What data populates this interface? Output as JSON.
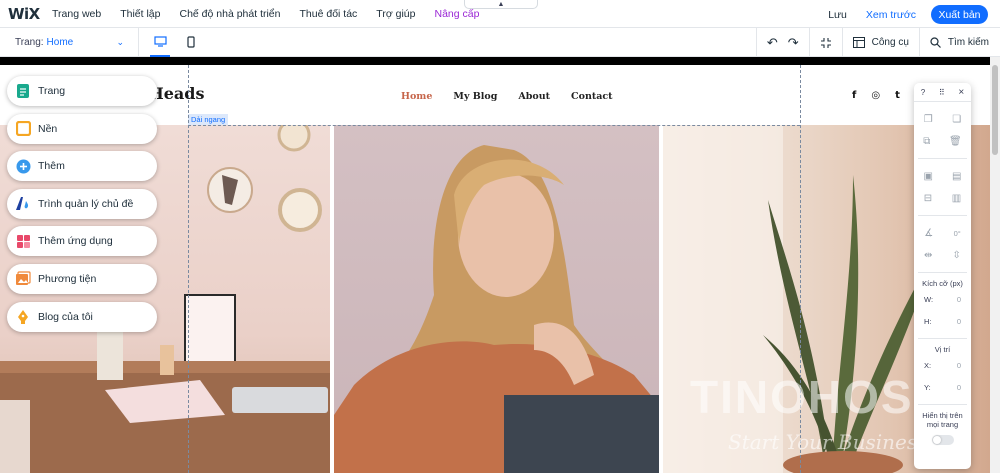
{
  "topbar": {
    "logo": "WiX",
    "menu": [
      "Trang web",
      "Thiết lập",
      "Chế độ nhà phát triển",
      "Thuê đối tác",
      "Trợ giúp",
      "Nâng cấp"
    ],
    "save": "Lưu",
    "preview": "Xem trước",
    "publish": "Xuất bản"
  },
  "toolbar": {
    "page_label": "Trang:",
    "page_value": "Home",
    "tools_label": "Công cụ",
    "search_label": "Tìm kiếm"
  },
  "site": {
    "title": "Turning Heads",
    "nav": [
      "Home",
      "My Blog",
      "About",
      "Contact"
    ],
    "social": [
      "f",
      "◎",
      "t"
    ],
    "strip_tag": "Dải ngang"
  },
  "left_panel": [
    {
      "label": "Trang",
      "icon": "page-icon",
      "color": "#19a98d"
    },
    {
      "label": "Nền",
      "icon": "background-icon",
      "color": "#f5a623"
    },
    {
      "label": "Thêm",
      "icon": "add-icon",
      "color": "#3899ec"
    },
    {
      "label": "Trình quản lý chủ đề",
      "icon": "theme-manager-icon",
      "color": "#1d3fa0"
    },
    {
      "label": "Thêm ứng dụng",
      "icon": "add-apps-icon",
      "color": "#e8496a"
    },
    {
      "label": "Phương tiện",
      "icon": "media-icon",
      "color": "#f08a3c"
    },
    {
      "label": "Blog của tôi",
      "icon": "blog-icon",
      "color": "#f5a623"
    }
  ],
  "right_panel": {
    "help": "?",
    "close": "×",
    "size_title": "Kích cỡ (px)",
    "w_label": "W:",
    "w_value": "0",
    "h_label": "H:",
    "h_value": "0",
    "rotate_value": "0°",
    "position_title": "Vị trí",
    "x_label": "X:",
    "x_value": "0",
    "y_label": "Y:",
    "y_value": "0",
    "show_title": "Hiển thị trên mọi trang"
  },
  "watermark": {
    "main": "TINOHOST",
    "sub": "Start Your Business"
  }
}
